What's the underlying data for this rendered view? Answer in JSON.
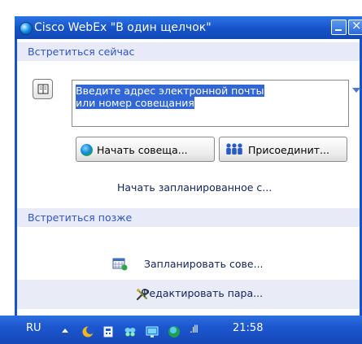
{
  "window": {
    "title": "Cisco WebEx \"В один щелчок\""
  },
  "meet_now": {
    "header": "Встретиться сейчас",
    "address_field": {
      "value": "Введите адрес электронной почты или номер совещания"
    },
    "start_button_label": "Начать совеща...",
    "join_button_label": "Присоединит...",
    "scheduled_link": "Начать запланированное с..."
  },
  "meet_later": {
    "header": "Встретиться позже",
    "schedule_link": "Запланировать сове...",
    "preferences_link": "Редактировать пара..."
  },
  "taskbar": {
    "language": "RU",
    "signal": ".ıll",
    "clock": "21:58"
  },
  "icons": {
    "app": "webex-globe-icon",
    "address_book": "address-book-icon",
    "start": "globe-icon",
    "join": "people-icon",
    "schedule": "calendar-icon",
    "preferences": "tools-icon"
  },
  "colors": {
    "titlebar": "#1652c8",
    "section_header_text": "#2d55c8",
    "section_header_bg": "#e8eaf7",
    "selection": "#3166d6"
  }
}
